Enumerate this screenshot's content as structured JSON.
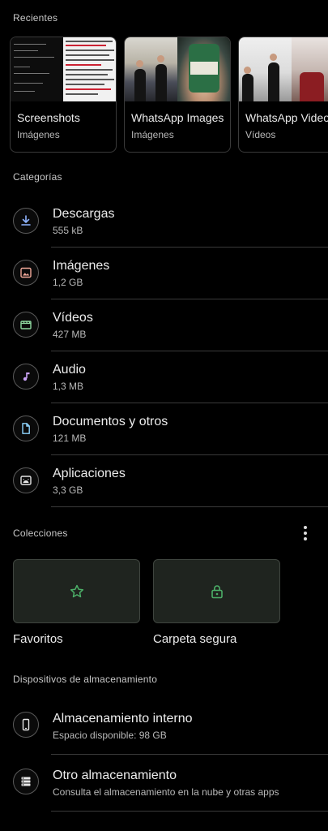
{
  "recientes": {
    "title": "Recientes",
    "cards": [
      {
        "title": "Screenshots",
        "subtitle": "Imágenes"
      },
      {
        "title": "WhatsApp Images",
        "subtitle": "Imágenes"
      },
      {
        "title": "WhatsApp Video",
        "subtitle": "Vídeos"
      }
    ]
  },
  "categorias": {
    "title": "Categorías",
    "items": [
      {
        "title": "Descargas",
        "size": "555 kB",
        "icon": "download-icon",
        "color": "#8fb4ff"
      },
      {
        "title": "Imágenes",
        "size": "1,2 GB",
        "icon": "image-icon",
        "color": "#f2a99a"
      },
      {
        "title": "Vídeos",
        "size": "427 MB",
        "icon": "video-icon",
        "color": "#8fd9a0"
      },
      {
        "title": "Audio",
        "size": "1,3 MB",
        "icon": "music-note-icon",
        "color": "#c9a2f5"
      },
      {
        "title": "Documentos y otros",
        "size": "121 MB",
        "icon": "document-icon",
        "color": "#8fd5ff"
      },
      {
        "title": "Aplicaciones",
        "size": "3,3 GB",
        "icon": "android-icon",
        "color": "#e6e6e6"
      }
    ]
  },
  "colecciones": {
    "title": "Colecciones",
    "items": [
      {
        "label": "Favoritos",
        "icon": "star-icon"
      },
      {
        "label": "Carpeta segura",
        "icon": "lock-icon"
      }
    ],
    "accent": "#4caf68"
  },
  "almacenamiento": {
    "title": "Dispositivos de almacenamiento",
    "items": [
      {
        "title": "Almacenamiento interno",
        "subtitle": "Espacio disponible: 98 GB",
        "icon": "phone-icon"
      },
      {
        "title": "Otro almacenamiento",
        "subtitle": "Consulta el almacenamiento en la nube y otras apps",
        "icon": "storage-icon"
      }
    ]
  }
}
